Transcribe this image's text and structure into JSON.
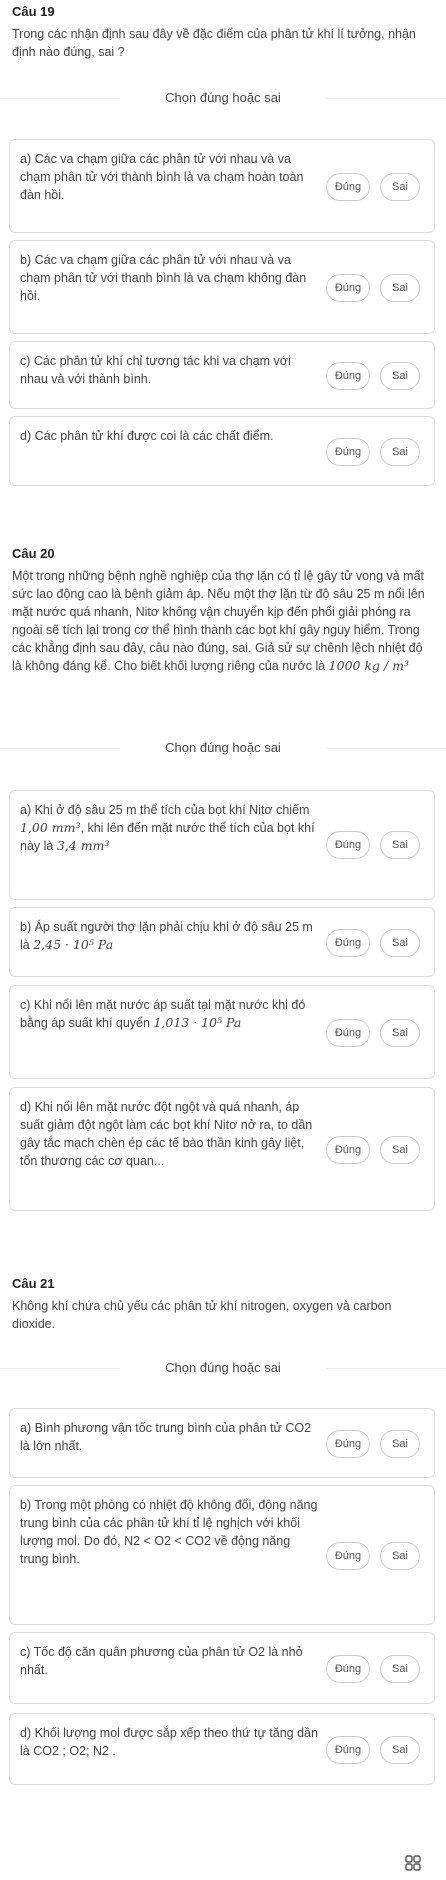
{
  "q19": {
    "title": "Câu 19",
    "text": "Trong các nhận định sau đây về đặc điểm của phân tử khí lí tưởng, nhận định nào đúng, sai ?",
    "section_label": "Chọn đúng hoặc sai",
    "items": [
      {
        "text": "a) Các va chạm giữa các phân tử với nhau và va chạm phân tử với thành bình là va chạm hoàn toàn đàn hồi."
      },
      {
        "text": "b) Các va chạm giữa các phân tử với nhau và va chạm phân tử với thanh bình là va chạm không đàn hồi."
      },
      {
        "text": "c) Các phân tử khí chỉ tương tác khi va chạm với nhau và với thành bình."
      },
      {
        "text": "d) Các phân tử khí được coi là các chất điểm."
      }
    ]
  },
  "q20": {
    "title": "Câu 20",
    "text": "Một trong những bệnh nghề nghiệp của thợ lặn có tỉ lệ gây tử vong và mất sức lao động cao là bệnh giảm áp. Nếu một thợ lặn từ độ sâu 25 m nổi lên mặt nước quá nhanh, Nitơ không vận chuyển kịp đến phổi giải phóng ra ngoài sẽ tích lại trong cơ thể hình thành các bọt khí gây nguy hiểm. Trong các khẳng định sau đây, câu nào đúng, sai. Giả sử sự chênh lệch nhiệt độ là không đáng kể. Cho biết khối lượng riêng của nước là",
    "text_math": "1000 kg / m³",
    "section_label": "Chọn đúng hoặc sai",
    "items": [
      {
        "text": "a) Khi ở độ sâu 25 m thể tích của bọt khí Nitơ chiếm",
        "math1": "1,00 mm³",
        "text2": ", khi lên đến mặt nước thể tích của bọt khí này là",
        "math2": "3,4 mm³"
      },
      {
        "text": "b) Áp suất người thợ lặn phải chịu khi ở độ sâu 25 m là",
        "math1": "2,45 · 10⁵ Pa"
      },
      {
        "text": "c) Khi nổi lên mặt nước áp suất tại mặt nước khi đó bằng áp suất khí quyển",
        "math1": "1,013 · 10⁵ Pa"
      },
      {
        "text": "d) Khi nổi lên mặt nước đột ngột và quá nhanh, áp suất giảm đột ngột làm các bọt khí Nitơ nở ra, to dần gây tắc mạch chèn ép các tế bào thần kinh gây liệt, tổn thương các cơ quan..."
      }
    ]
  },
  "q21": {
    "title": "Câu 21",
    "text": "Không khí chứa chủ yếu các phân tử khí nitrogen, oxygen và carbon dioxide.",
    "section_label": "Chọn đúng hoặc sai",
    "items": [
      {
        "text": "a) Bình phương vận tốc trung bình của phân tử CO2 là lớn nhất."
      },
      {
        "text": "b) Trong một phòng có nhiệt độ không đổi, động năng trung bình của các phân tử khí tỉ lệ nghịch với khối lượng mol. Do đó, N2 < O2 < CO2 về động năng trung bình."
      },
      {
        "text": "c) Tốc độ căn quân phương của phân tử O2 là nhỏ nhất."
      },
      {
        "text": "d) Khối lượng mol được sắp xếp theo thứ tự tăng dần là CO2 ; O2; N2 ."
      }
    ]
  },
  "buttons": {
    "true_label": "Đúng",
    "false_label": "Sai"
  },
  "icons": {
    "menu": "grid-icon"
  }
}
